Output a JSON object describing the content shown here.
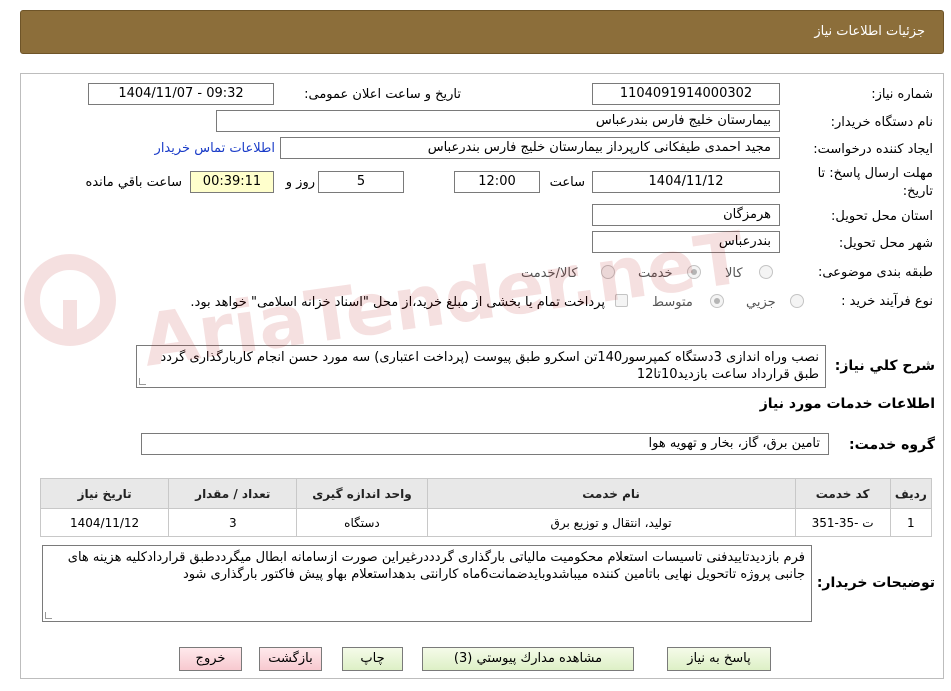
{
  "header": {
    "title": "جزئیات اطلاعات نیاز"
  },
  "fields": {
    "need_number_label": "شماره نیاز:",
    "need_number": "1104091914000302",
    "announce_label": "تاریخ و ساعت اعلان عمومی:",
    "announce_value": "1404/11/07 - 09:32",
    "buyer_org_label": "نام دستگاه خریدار:",
    "buyer_org": "بیمارستان خلیج فارس بندرعباس",
    "creator_label": "ایجاد کننده درخواست:",
    "creator": "مجید احمدی طیفکانی کارپرداز بیمارستان خلیج فارس بندرعباس",
    "contact_link": "اطلاعات تماس خریدار",
    "deadline_label_1": "مهلت ارسال پاسخ: تا",
    "deadline_label_2": "تاریخ:",
    "deadline_date": "1404/11/12",
    "time_label": "ساعت",
    "deadline_time": "12:00",
    "days_value": "5",
    "days_label": "روز و",
    "remaining_time": "00:39:11",
    "remaining_label": "ساعت باقي مانده",
    "province_label": "استان محل تحویل:",
    "province": "هرمزگان",
    "city_label": "شهر محل تحویل:",
    "city": "بندرعباس",
    "category_label": "طبقه بندی موضوعی:",
    "category_options": [
      "کالا",
      "خدمت",
      "کالا/خدمت"
    ],
    "category_selected": "خدمت",
    "process_label": "نوع فرآیند خرید :",
    "process_options": [
      "جزیي",
      "متوسط"
    ],
    "process_selected": "متوسط",
    "payment_note": "پرداخت تمام یا بخشی از مبلغ خرید،از محل \"اسناد خزانه اسلامی\" خواهد بود.",
    "description_label": "شرح کلي نیاز:",
    "description": "نصب وراه اندازی 3دستگاه کمپرسور140تن اسکرو طبق پیوست (پرداخت اعتباری) سه مورد حسن انجام کاربارگذاری گردد طبق قرارداد ساعت بازدید10تا12",
    "services_heading": "اطلاعات خدمات مورد نیاز",
    "service_group_label": "گروه خدمت:",
    "service_group": "تامین برق، گاز، بخار و تهویه هوا",
    "buyer_notes_label": "توضیحات خریدار:",
    "buyer_notes": "فرم بازدیدتاییدفنی تاسیسات استعلام محکومیت مالیاتی بارگذاری گردددرغیراین صورت ازسامانه ابطال میگرددطبق قراردادکلیه هزینه های جانبی پروژه تاتحویل نهایی باتامین کننده میباشدوبایدضمانت6ماه کارانتی بدهداستعلام بهاو پیش فاکتور بارگذاری شود"
  },
  "table": {
    "headers": [
      "ردیف",
      "کد خدمت",
      "نام خدمت",
      "واحد اندازه گیری",
      "تعداد / مقدار",
      "تاریخ نیاز"
    ],
    "rows": [
      [
        "1",
        "ت -35-351",
        "تولید، انتقال و توزیع برق",
        "دستگاه",
        "3",
        "1404/11/12"
      ]
    ]
  },
  "buttons": {
    "reply": "پاسخ به نیاز",
    "attachments": "مشاهده مدارك پیوستي (3)",
    "print": "چاپ",
    "back": "بازگشت",
    "exit": "خروج"
  },
  "watermark": {
    "text": "AriaTender.neT"
  },
  "colors": {
    "header_bg": "#8c6e3a",
    "button_green": "#ddf0c6",
    "button_pink": "#f7c9cf",
    "timer_bg": "#ffffcc",
    "link": "#1a3cc8"
  }
}
